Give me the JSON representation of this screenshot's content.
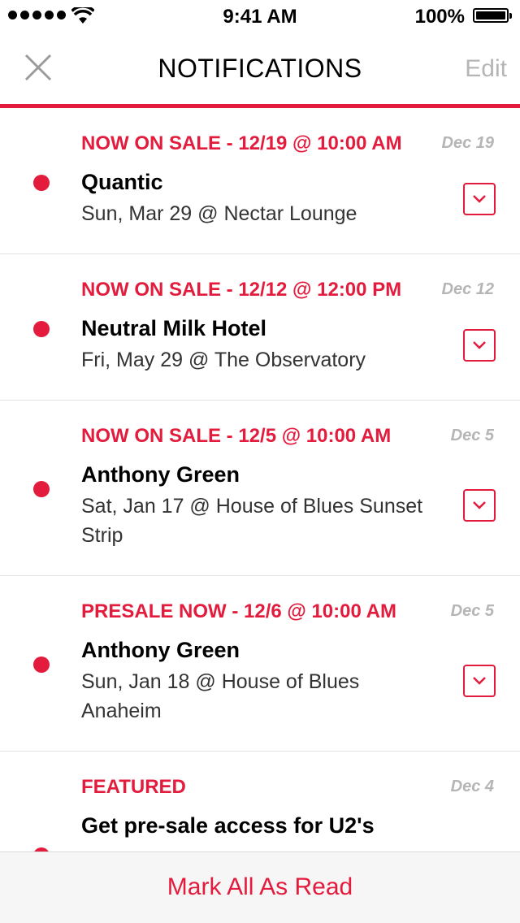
{
  "status_bar": {
    "time": "9:41 AM",
    "battery": "100%",
    "battery_level": 1.0,
    "signal_bars": 5
  },
  "nav": {
    "title": "NOTIFICATIONS",
    "edit_label": "Edit",
    "close_icon": "close-icon"
  },
  "colors": {
    "accent": "#e31c3d",
    "muted": "#b5b5b5"
  },
  "notifications": [
    {
      "title": "NOW ON SALE - 12/19 @ 10:00 AM",
      "date": "Dec 19",
      "artist": "Quantic",
      "detail": "Sun, Mar 29 @ Nectar Lounge",
      "unread": true
    },
    {
      "title": "NOW ON SALE - 12/12 @ 12:00 PM",
      "date": "Dec 12",
      "artist": "Neutral Milk Hotel",
      "detail": "Fri, May 29 @ The Observatory",
      "unread": true
    },
    {
      "title": "NOW ON SALE - 12/5 @ 10:00 AM",
      "date": "Dec 5",
      "artist": "Anthony Green",
      "detail": "Sat, Jan 17 @ House of Blues Sunset Strip",
      "unread": true
    },
    {
      "title": "PRESALE NOW - 12/6 @ 10:00 AM",
      "date": "Dec 5",
      "artist": "Anthony Green",
      "detail": "Sun, Jan 18 @ House of Blues Anaheim",
      "unread": true
    },
    {
      "title": "FEATURED",
      "date": "Dec 4",
      "artist": "Get pre-sale access for U2's",
      "detail": "",
      "unread": true
    }
  ],
  "footer": {
    "mark_all_label": "Mark All As Read"
  }
}
